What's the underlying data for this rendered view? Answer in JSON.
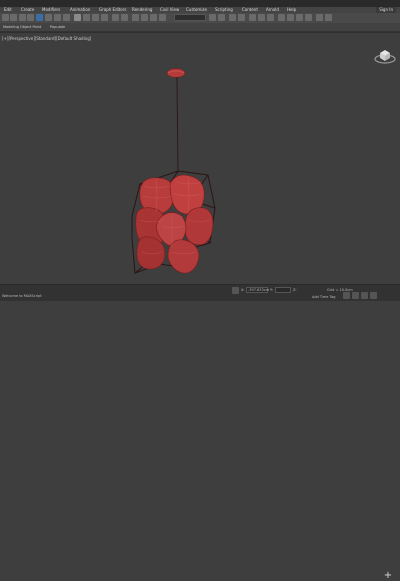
{
  "menu": {
    "items": [
      "Edit",
      "Create",
      "Modifiers",
      "Animation",
      "Graph Editors",
      "Rendering",
      "Civil View",
      "Customize",
      "Scripting",
      "Content",
      "Arnold",
      "Help"
    ],
    "sign_in": "Sign In"
  },
  "ribbon": {
    "tabs": [
      "Modeling",
      "Object Paint",
      "Populate"
    ]
  },
  "viewport": {
    "label": "[+][Perspective][Standard][Default Shading]"
  },
  "statusbar": {
    "left_text": "Welcome to MAXScript",
    "add_time_tag": "Add Time Tag",
    "x_label": "X:",
    "x_value": "-397.633cm",
    "y_label": "Y:",
    "y_value": "",
    "z_label": "Z:",
    "grid": "Grid = 10.0cm",
    "plus": "+"
  },
  "colors": {
    "object": "#b03a3a",
    "wire": "#7a1c1c",
    "selection_blue": "#3c6ea6"
  }
}
